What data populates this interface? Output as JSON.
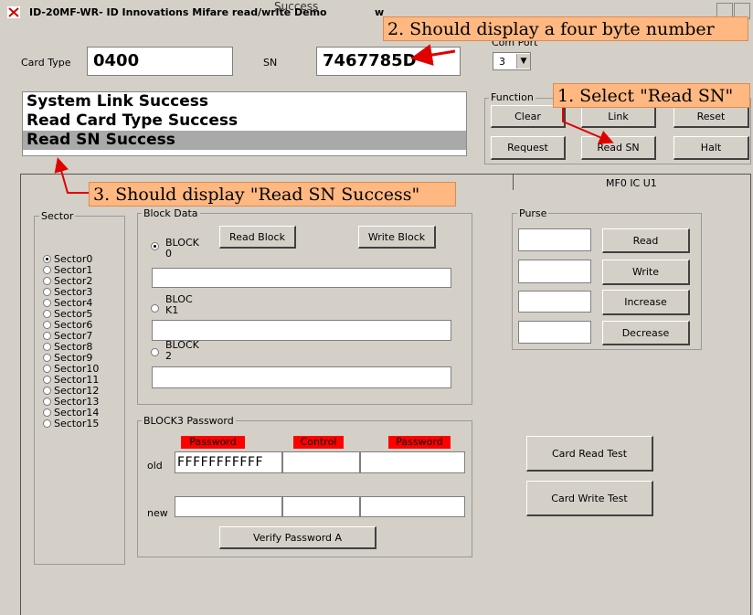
{
  "window": {
    "title": "ID-20MF-WR- ID Innovations Mifare read/write Demo",
    "title_extra": "w",
    "top_partial": "Success"
  },
  "card_type": {
    "label": "Card Type",
    "value": "0400"
  },
  "sn": {
    "label": "SN",
    "value": "7467785D"
  },
  "com_port": {
    "label": "Com Port",
    "value": "3"
  },
  "log": {
    "lines": [
      "System Link Success",
      "Read Card Type Success",
      "Read SN Success"
    ]
  },
  "function": {
    "label": "Function",
    "buttons": [
      "Clear",
      "Link",
      "Reset",
      "Request",
      "Read SN",
      "Halt"
    ]
  },
  "tabs": {
    "right": "MF0 IC U1"
  },
  "sector": {
    "label": "Sector",
    "items": [
      "Sector0",
      "Sector1",
      "Sector2",
      "Sector3",
      "Sector4",
      "Sector5",
      "Sector6",
      "Sector7",
      "Sector8",
      "Sector9",
      "Sector10",
      "Sector11",
      "Sector12",
      "Sector13",
      "Sector14",
      "Sector15"
    ]
  },
  "block_data": {
    "label": "Block Data",
    "read_block": "Read Block",
    "write_block": "Write Block",
    "block0": "BLOCK 0",
    "block1": "BLOC K1",
    "block2": "BLOCK 2"
  },
  "password": {
    "label": "BLOCK3 Password",
    "col1": "Password",
    "col2": "Control",
    "col3": "Password",
    "old_label": "old",
    "new_label": "new",
    "old_value": "FFFFFFFFFFF",
    "verify": "Verify Password A"
  },
  "purse": {
    "label": "Purse",
    "buttons": [
      "Read",
      "Write",
      "Increase",
      "Decrease"
    ]
  },
  "tests": {
    "read": "Card Read Test",
    "write": "Card Write Test"
  },
  "callouts": {
    "c1": "1. Select \"Read SN\"",
    "c2": "2. Should display a four byte number",
    "c3": "3. Should display \"Read SN Success\""
  },
  "colors": {
    "callout": "#ffb882",
    "arrow": "#e00000",
    "dialog": "#d4d0c8",
    "redlabel": "#ff0000"
  }
}
